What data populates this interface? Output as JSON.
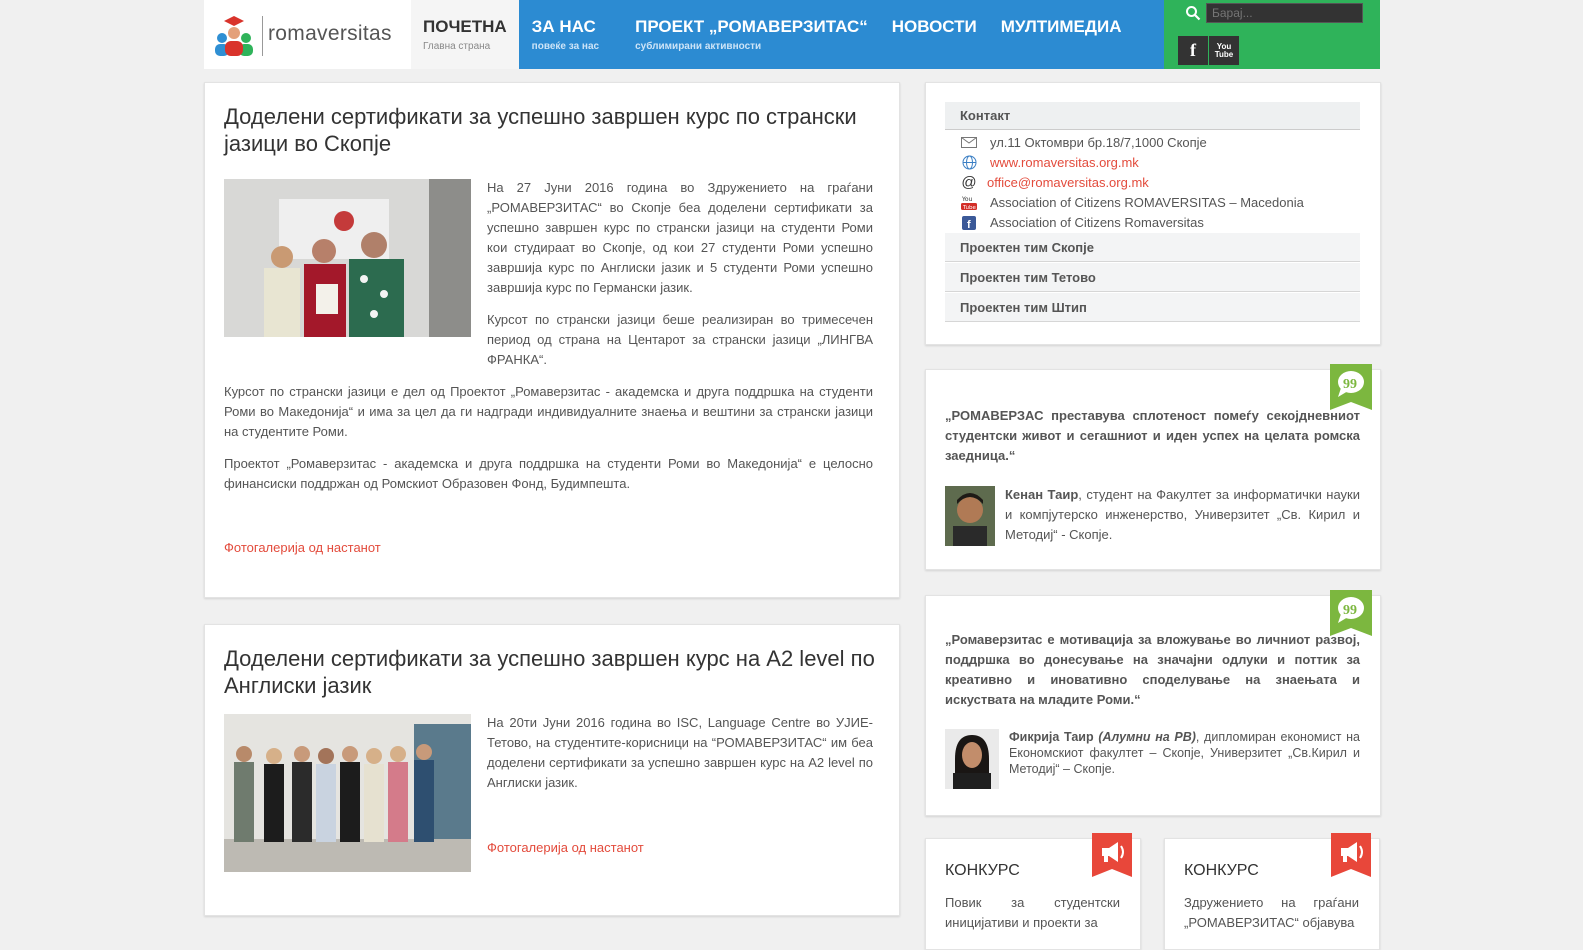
{
  "header": {
    "logo_text": "romaversitas",
    "nav": [
      {
        "title": "ПОЧЕТНА",
        "sub": "Главна страна"
      },
      {
        "title": "ЗА НАС",
        "sub": "повеќе за нас"
      },
      {
        "title": "ПРОЕКТ „РОМАВЕРЗИТАС“",
        "sub": "сублимирани активности"
      },
      {
        "title": "НОВОСТИ",
        "sub": ""
      },
      {
        "title": "МУЛТИМЕДИА",
        "sub": ""
      }
    ],
    "search_placeholder": "Барај...",
    "social": [
      {
        "icon": "facebook-icon",
        "glyph": "f"
      },
      {
        "icon": "youtube-icon",
        "glyph": "You Tube"
      }
    ]
  },
  "articles": [
    {
      "title": "Доделени сертификати за успешно завршен курс по странски јазици во Скопје",
      "p1": "На 27 Јуни 2016 година во Здружението на граѓани „РОМАВЕРЗИТАС“ во Скопје беа доделени сертификати за успешно завршен курс по странски јазици на студенти Роми кои студираат во Скопје, од кои 27 студенти Роми успешно завршија курс по Англиски јазик и 5 студенти Роми успешно завршија курс по Германски јазик.",
      "p2": "Курсот по странски јазици беше реализиран во тримесечен период од страна на Центарот за странски јазици „ЛИНГВА ФРАНКА“.",
      "p3": "Курсот по странски јазици е дел од Проектот „Ромаверзитас - академска и друга поддршка на студенти Роми во Македонија“ и има за цел да ги надгради индивидуалните знаења и вештини за странски јазици на студентите Роми.",
      "p4": "Проектот „Ромаверзитас - академска и друга поддршка на студенти Роми во Македонија“ е целосно финансиски поддржан од Ромскиот Образовен Фонд, Будимпешта.",
      "gallery_link": "Фотогалерија од настанот"
    },
    {
      "title": "Доделени сертификати за успешно завршен курс на А2 level по Англиски јазик",
      "p1": "На 20ти Јуни 2016 година во ISC, Language Centre во УЈИЕ-Тетово, на студентите-корисници на “РОМАВЕРЗИТАС“ им беа доделени сертификати за успешно завршен курс на A2 level по Англиски јазик.",
      "gallery_link": "Фотогалерија од настанот"
    }
  ],
  "sidebar": {
    "contact_title": "Контакт",
    "address": "ул.11 Октомври бр.18/7,1000 Скопје",
    "website": "www.romaversitas.org.mk",
    "email": "office@romaversitas.org.mk",
    "youtube": "Association of Citizens ROMAVERSITAS – Macedonia",
    "facebook": "Association of Citizens Romaversitas",
    "teams": [
      "Проектен тим Скопје",
      "Проектен тим Тетово",
      "Проектен тим Штип"
    ],
    "quotes": [
      {
        "text": "„РОМАВЕРЗАС преставува сплотеност помеѓу секојдневниот студентски живот и сегашниот и иден успех на целата ромска заедница.“",
        "name": "Кенан Таир",
        "note": "",
        "desc": ", студент на Факултет за информатички науки и компјутерско инженерство, Универзитет „Св. Кирил и Методиј“ - Скопје."
      },
      {
        "text": "„Ромаверзитас е мотивација за вложување во личниот развој, поддршка во донесување на значајни одлуки и поттик за креативно и иновативно споделување на знаењата и искуствата на младите Роми.“",
        "name": "Фикрија Таир",
        "note": "(Алумни на РВ)",
        "desc": ", дипломиран економист на Економскиот факултет – Скопје, Универзитет „Св.Кирил и Методиј“ – Скопје."
      }
    ],
    "konkurs": [
      {
        "title": "КОНКУРС",
        "text": "Повик за студентски иницијативи и проекти за"
      },
      {
        "title": "КОНКУРС",
        "text": "Здружението на граѓани „РОМАВЕРЗИТАС“ објавува"
      }
    ]
  }
}
